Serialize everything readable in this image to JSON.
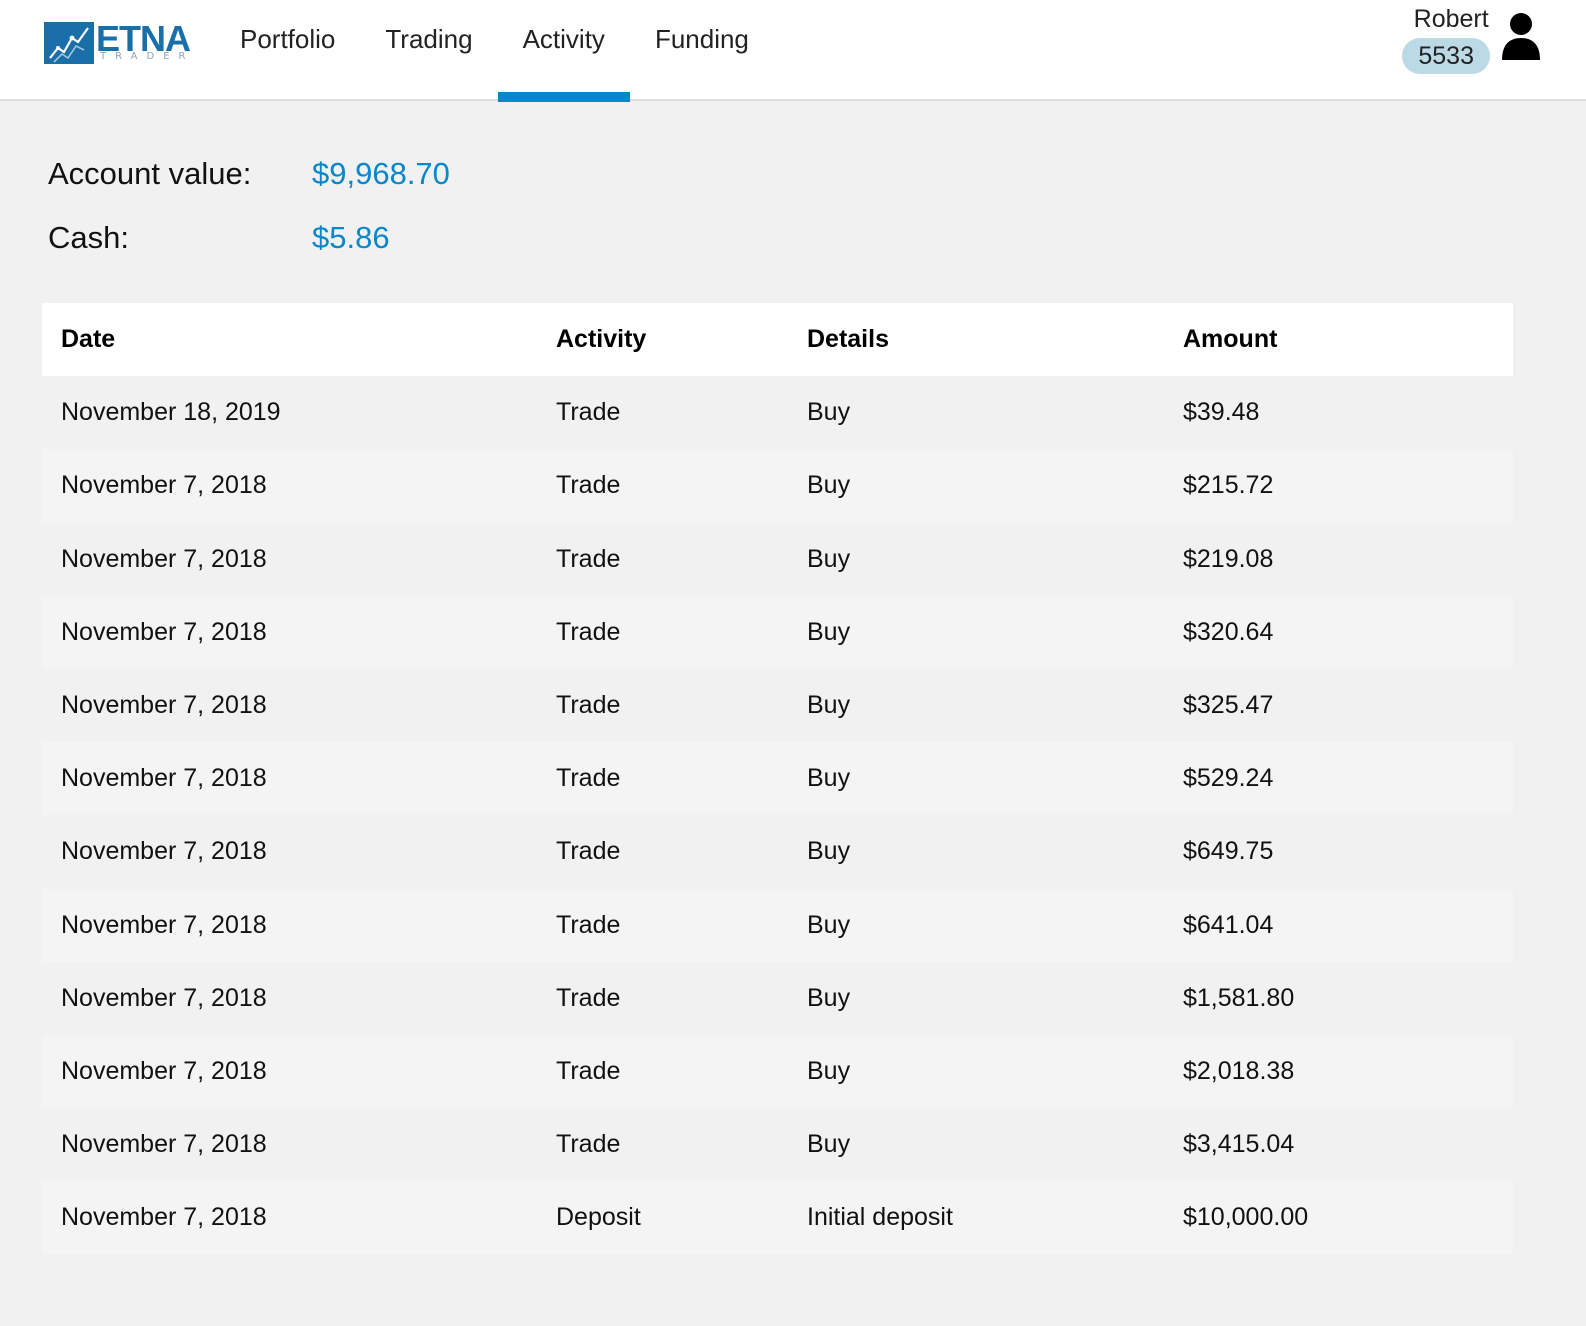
{
  "brand": {
    "name": "ETNA",
    "subtitle": "TRADER",
    "color": "#1a6fa8"
  },
  "nav": {
    "items": [
      {
        "label": "Portfolio",
        "active": false
      },
      {
        "label": "Trading",
        "active": false
      },
      {
        "label": "Activity",
        "active": true
      },
      {
        "label": "Funding",
        "active": false
      }
    ],
    "accent_color": "#0a86c9"
  },
  "user": {
    "name": "Robert",
    "account_badge": "5533",
    "icon": "user-icon"
  },
  "summary": {
    "account_value_label": "Account value:",
    "account_value": "$9,968.70",
    "cash_label": "Cash:",
    "cash": "$5.86"
  },
  "table": {
    "columns": [
      "Date",
      "Activity",
      "Details",
      "Amount"
    ],
    "rows": [
      {
        "date": "November 18, 2019",
        "activity": "Trade",
        "details": "Buy",
        "amount": "$39.48"
      },
      {
        "date": "November 7, 2018",
        "activity": "Trade",
        "details": "Buy",
        "amount": "$215.72"
      },
      {
        "date": "November 7, 2018",
        "activity": "Trade",
        "details": "Buy",
        "amount": "$219.08"
      },
      {
        "date": "November 7, 2018",
        "activity": "Trade",
        "details": "Buy",
        "amount": "$320.64"
      },
      {
        "date": "November 7, 2018",
        "activity": "Trade",
        "details": "Buy",
        "amount": "$325.47"
      },
      {
        "date": "November 7, 2018",
        "activity": "Trade",
        "details": "Buy",
        "amount": "$529.24"
      },
      {
        "date": "November 7, 2018",
        "activity": "Trade",
        "details": "Buy",
        "amount": "$649.75"
      },
      {
        "date": "November 7, 2018",
        "activity": "Trade",
        "details": "Buy",
        "amount": "$641.04"
      },
      {
        "date": "November 7, 2018",
        "activity": "Trade",
        "details": "Buy",
        "amount": "$1,581.80"
      },
      {
        "date": "November 7, 2018",
        "activity": "Trade",
        "details": "Buy",
        "amount": "$2,018.38"
      },
      {
        "date": "November 7, 2018",
        "activity": "Trade",
        "details": "Buy",
        "amount": "$3,415.04"
      },
      {
        "date": "November 7, 2018",
        "activity": "Deposit",
        "details": "Initial deposit",
        "amount": "$10,000.00"
      }
    ]
  }
}
